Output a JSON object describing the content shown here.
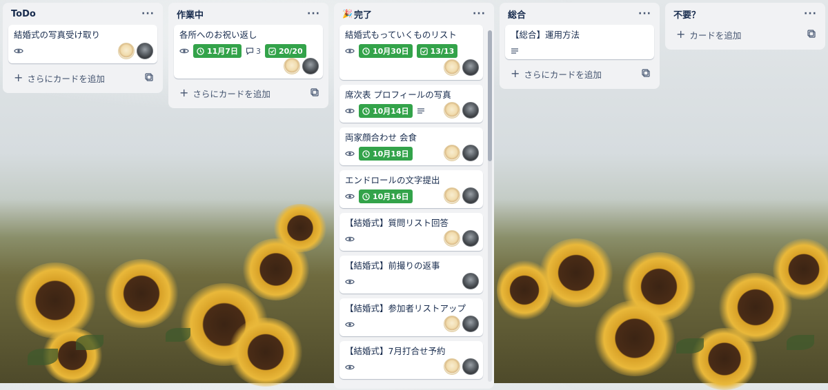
{
  "lists": [
    {
      "title": "ToDo",
      "menu": "···",
      "cards": [
        {
          "title": "結婚式の写真受け取り"
        }
      ],
      "add_label": "さらにカードを追加"
    },
    {
      "title": "作業中",
      "menu": "···",
      "cards": [
        {
          "title": "各所へのお祝い返し",
          "due": "11月7日",
          "comments": "3",
          "checklist": "20/20"
        }
      ],
      "add_label": "さらにカードを追加"
    },
    {
      "title": "完了",
      "emoji": "🎉",
      "menu": "···",
      "cards": [
        {
          "title": "結婚式もっていくものリスト",
          "due": "10月30日",
          "checklist": "13/13"
        },
        {
          "title": "席次表 プロフィールの写真",
          "due": "10月14日"
        },
        {
          "title": "両家顔合わせ 会食",
          "due": "10月18日"
        },
        {
          "title": "エンドロールの文字提出",
          "due": "10月16日"
        },
        {
          "title": "【結婚式】質問リスト回答"
        },
        {
          "title": "【結婚式】前撮りの返事"
        },
        {
          "title": "【結婚式】参加者リストアップ"
        },
        {
          "title": "【結婚式】7月打合せ予約"
        }
      ]
    },
    {
      "title": "総合",
      "menu": "···",
      "cards": [
        {
          "title": "【総合】運用方法"
        }
      ],
      "add_label": "さらにカードを追加"
    },
    {
      "title": "不要？",
      "menu": "···",
      "add_label": "カードを追加"
    }
  ],
  "icons": {
    "watch": "eye-icon",
    "due": "clock-icon",
    "checklist": "checkbox-icon",
    "comments": "comment-icon",
    "description": "description-icon",
    "add": "plus-icon",
    "template": "template-icon",
    "menu": "more-icon"
  },
  "colors": {
    "badge_complete": "#33a34a",
    "list_bg": "#f1f2f4",
    "card_bg": "#ffffff"
  }
}
